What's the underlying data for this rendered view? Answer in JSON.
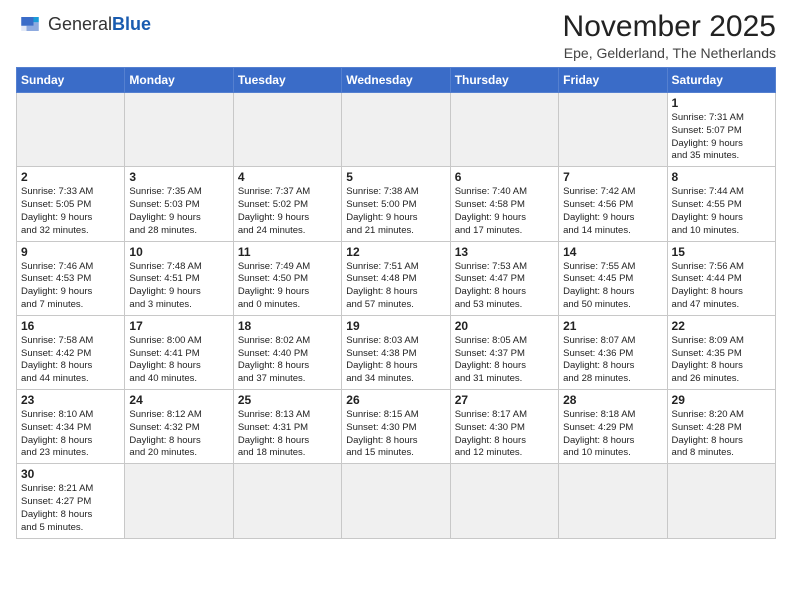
{
  "header": {
    "logo_general": "General",
    "logo_blue": "Blue",
    "month_year": "November 2025",
    "location": "Epe, Gelderland, The Netherlands"
  },
  "weekdays": [
    "Sunday",
    "Monday",
    "Tuesday",
    "Wednesday",
    "Thursday",
    "Friday",
    "Saturday"
  ],
  "days": [
    {
      "num": "",
      "info": "",
      "empty": true
    },
    {
      "num": "",
      "info": "",
      "empty": true
    },
    {
      "num": "",
      "info": "",
      "empty": true
    },
    {
      "num": "",
      "info": "",
      "empty": true
    },
    {
      "num": "",
      "info": "",
      "empty": true
    },
    {
      "num": "",
      "info": "",
      "empty": true
    },
    {
      "num": "1",
      "info": "Sunrise: 7:31 AM\nSunset: 5:07 PM\nDaylight: 9 hours\nand 35 minutes."
    },
    {
      "num": "2",
      "info": "Sunrise: 7:33 AM\nSunset: 5:05 PM\nDaylight: 9 hours\nand 32 minutes."
    },
    {
      "num": "3",
      "info": "Sunrise: 7:35 AM\nSunset: 5:03 PM\nDaylight: 9 hours\nand 28 minutes."
    },
    {
      "num": "4",
      "info": "Sunrise: 7:37 AM\nSunset: 5:02 PM\nDaylight: 9 hours\nand 24 minutes."
    },
    {
      "num": "5",
      "info": "Sunrise: 7:38 AM\nSunset: 5:00 PM\nDaylight: 9 hours\nand 21 minutes."
    },
    {
      "num": "6",
      "info": "Sunrise: 7:40 AM\nSunset: 4:58 PM\nDaylight: 9 hours\nand 17 minutes."
    },
    {
      "num": "7",
      "info": "Sunrise: 7:42 AM\nSunset: 4:56 PM\nDaylight: 9 hours\nand 14 minutes."
    },
    {
      "num": "8",
      "info": "Sunrise: 7:44 AM\nSunset: 4:55 PM\nDaylight: 9 hours\nand 10 minutes."
    },
    {
      "num": "9",
      "info": "Sunrise: 7:46 AM\nSunset: 4:53 PM\nDaylight: 9 hours\nand 7 minutes."
    },
    {
      "num": "10",
      "info": "Sunrise: 7:48 AM\nSunset: 4:51 PM\nDaylight: 9 hours\nand 3 minutes."
    },
    {
      "num": "11",
      "info": "Sunrise: 7:49 AM\nSunset: 4:50 PM\nDaylight: 9 hours\nand 0 minutes."
    },
    {
      "num": "12",
      "info": "Sunrise: 7:51 AM\nSunset: 4:48 PM\nDaylight: 8 hours\nand 57 minutes."
    },
    {
      "num": "13",
      "info": "Sunrise: 7:53 AM\nSunset: 4:47 PM\nDaylight: 8 hours\nand 53 minutes."
    },
    {
      "num": "14",
      "info": "Sunrise: 7:55 AM\nSunset: 4:45 PM\nDaylight: 8 hours\nand 50 minutes."
    },
    {
      "num": "15",
      "info": "Sunrise: 7:56 AM\nSunset: 4:44 PM\nDaylight: 8 hours\nand 47 minutes."
    },
    {
      "num": "16",
      "info": "Sunrise: 7:58 AM\nSunset: 4:42 PM\nDaylight: 8 hours\nand 44 minutes."
    },
    {
      "num": "17",
      "info": "Sunrise: 8:00 AM\nSunset: 4:41 PM\nDaylight: 8 hours\nand 40 minutes."
    },
    {
      "num": "18",
      "info": "Sunrise: 8:02 AM\nSunset: 4:40 PM\nDaylight: 8 hours\nand 37 minutes."
    },
    {
      "num": "19",
      "info": "Sunrise: 8:03 AM\nSunset: 4:38 PM\nDaylight: 8 hours\nand 34 minutes."
    },
    {
      "num": "20",
      "info": "Sunrise: 8:05 AM\nSunset: 4:37 PM\nDaylight: 8 hours\nand 31 minutes."
    },
    {
      "num": "21",
      "info": "Sunrise: 8:07 AM\nSunset: 4:36 PM\nDaylight: 8 hours\nand 28 minutes."
    },
    {
      "num": "22",
      "info": "Sunrise: 8:09 AM\nSunset: 4:35 PM\nDaylight: 8 hours\nand 26 minutes."
    },
    {
      "num": "23",
      "info": "Sunrise: 8:10 AM\nSunset: 4:34 PM\nDaylight: 8 hours\nand 23 minutes."
    },
    {
      "num": "24",
      "info": "Sunrise: 8:12 AM\nSunset: 4:32 PM\nDaylight: 8 hours\nand 20 minutes."
    },
    {
      "num": "25",
      "info": "Sunrise: 8:13 AM\nSunset: 4:31 PM\nDaylight: 8 hours\nand 18 minutes."
    },
    {
      "num": "26",
      "info": "Sunrise: 8:15 AM\nSunset: 4:30 PM\nDaylight: 8 hours\nand 15 minutes."
    },
    {
      "num": "27",
      "info": "Sunrise: 8:17 AM\nSunset: 4:30 PM\nDaylight: 8 hours\nand 12 minutes."
    },
    {
      "num": "28",
      "info": "Sunrise: 8:18 AM\nSunset: 4:29 PM\nDaylight: 8 hours\nand 10 minutes."
    },
    {
      "num": "29",
      "info": "Sunrise: 8:20 AM\nSunset: 4:28 PM\nDaylight: 8 hours\nand 8 minutes."
    },
    {
      "num": "30",
      "info": "Sunrise: 8:21 AM\nSunset: 4:27 PM\nDaylight: 8 hours\nand 5 minutes."
    },
    {
      "num": "",
      "info": "",
      "empty": true
    },
    {
      "num": "",
      "info": "",
      "empty": true
    },
    {
      "num": "",
      "info": "",
      "empty": true
    },
    {
      "num": "",
      "info": "",
      "empty": true
    },
    {
      "num": "",
      "info": "",
      "empty": true
    },
    {
      "num": "",
      "info": "",
      "empty": true
    }
  ]
}
